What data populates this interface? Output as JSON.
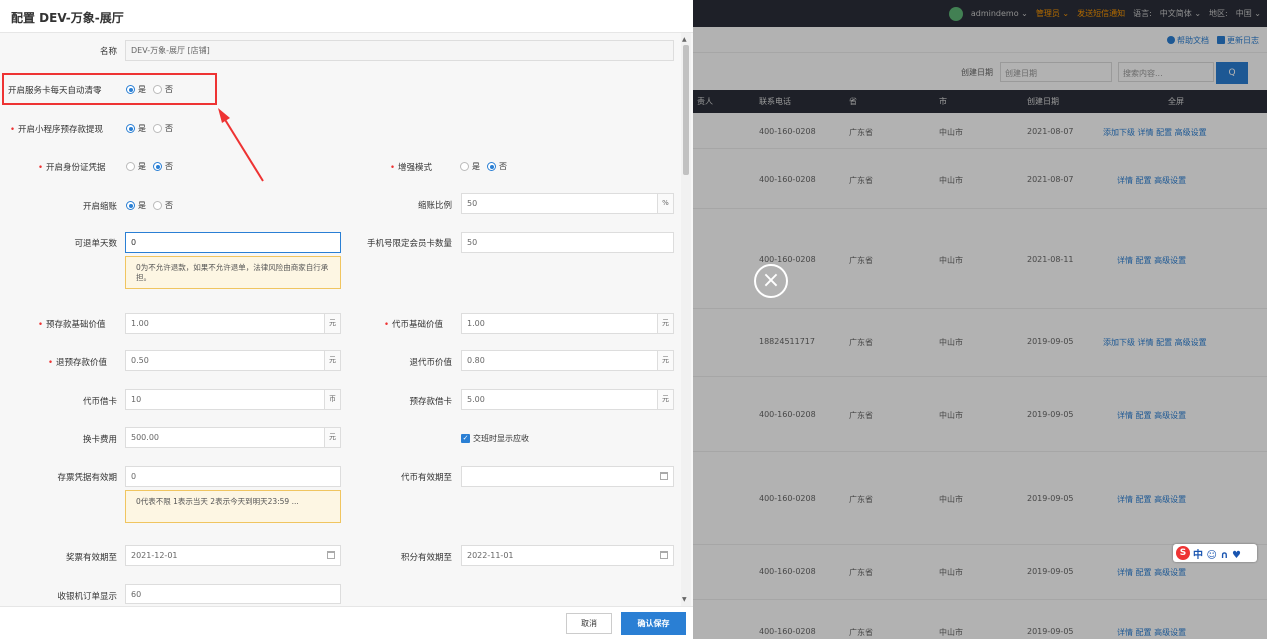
{
  "topbar": {
    "user": "admindemo ⌄",
    "role": "管理员 ⌄",
    "sms": "发送短信通知",
    "lang_label": "语言:",
    "lang_value": "中文简体 ⌄",
    "region_label": "地区:",
    "region_value": "中国 ⌄"
  },
  "subbar": {
    "help": "帮助文档",
    "changelog": "更新日志"
  },
  "filter": {
    "date_label": "创建日期",
    "date_select": "创建日期",
    "search_placeholder": "搜索内容...",
    "search_button": "Q"
  },
  "table": {
    "headers": [
      "责人",
      "联系电话",
      "省",
      "市",
      "创建日期",
      "全屏"
    ],
    "rows": [
      {
        "phone": "400-160-0208",
        "province": "广东省",
        "city": "中山市",
        "date": "2021-08-07",
        "actions": "添加下级 详情 配置 高级设置"
      },
      {
        "phone": "400-160-0208",
        "province": "广东省",
        "city": "中山市",
        "date": "2021-08-07",
        "actions": "详情 配置 高级设置"
      },
      {
        "phone": "400-160-0208",
        "province": "广东省",
        "city": "中山市",
        "date": "2021-08-11",
        "actions": "详情 配置 高级设置"
      },
      {
        "phone": "18824511717",
        "province": "广东省",
        "city": "中山市",
        "date": "2019-09-05",
        "actions": "添加下级 详情 配置 高级设置"
      },
      {
        "phone": "400-160-0208",
        "province": "广东省",
        "city": "中山市",
        "date": "2019-09-05",
        "actions": "详情 配置 高级设置"
      },
      {
        "phone": "400-160-0208",
        "province": "广东省",
        "city": "中山市",
        "date": "2019-09-05",
        "actions": "详情 配置 高级设置"
      },
      {
        "phone": "400-160-0208",
        "province": "广东省",
        "city": "中山市",
        "date": "2019-09-05",
        "actions": "详情 配置 高级设置"
      },
      {
        "phone": "400-160-0208",
        "province": "广东省",
        "city": "中山市",
        "date": "2019-09-05",
        "actions": "详情 配置 高级设置"
      }
    ]
  },
  "ime": {
    "logo": "S",
    "chars": "中 ☺ ∩ ♥"
  },
  "dialog": {
    "title": "配置 DEV-万象-展厅",
    "name_label": "名称",
    "name_value": "DEV-万象-展厅 [店铺]",
    "service_card_label": "开启服务卡每天自动清零",
    "miniapp_label": "开启小程序预存款提现",
    "idcard_label": "开启身份证凭据",
    "enhance_label": "增强模式",
    "shrink_label": "开启缩账",
    "shrink_ratio_label": "缩账比例",
    "shrink_ratio_value": "50",
    "shrink_ratio_unit": "%",
    "refund_days_label": "可退单天数",
    "refund_days_value": "0",
    "refund_hint": "0为不允许退款，如果不允许退单，法律风险由商家自行承担。",
    "phone_limit_label": "手机号限定会员卡数量",
    "phone_limit_value": "50",
    "prestore_base_label": "预存款基础价值",
    "prestore_base_value": "1.00",
    "token_base_label": "代币基础价值",
    "token_base_value": "1.00",
    "refund_prestore_label": "退预存款价值",
    "refund_prestore_value": "0.50",
    "refund_token_label": "退代币价值",
    "refund_token_value": "0.80",
    "token_borrow_label": "代币借卡",
    "token_borrow_value": "10",
    "prestore_borrow_label": "预存款借卡",
    "prestore_borrow_value": "5.00",
    "card_fee_label": "换卡费用",
    "card_fee_value": "500.00",
    "shift_show_label": "交班时显示应收",
    "ticket_valid_label": "存票凭据有效期",
    "ticket_valid_value": "0",
    "ticket_hint": "0代表不限 1表示当天 2表示今天到明天23:59 ...",
    "token_valid_label": "代币有效期至",
    "token_valid_value": "",
    "award_valid_label": "奖票有效期至",
    "award_valid_value": "2021-12-01",
    "points_valid_label": "积分有效期至",
    "points_valid_value": "2022-11-01",
    "pos_display_label": "收银机订单显示",
    "pos_display_value": "60",
    "yes": "是",
    "no": "否",
    "unit_yuan": "元",
    "unit_bi": "币",
    "cancel": "取消",
    "confirm": "确认保存"
  }
}
